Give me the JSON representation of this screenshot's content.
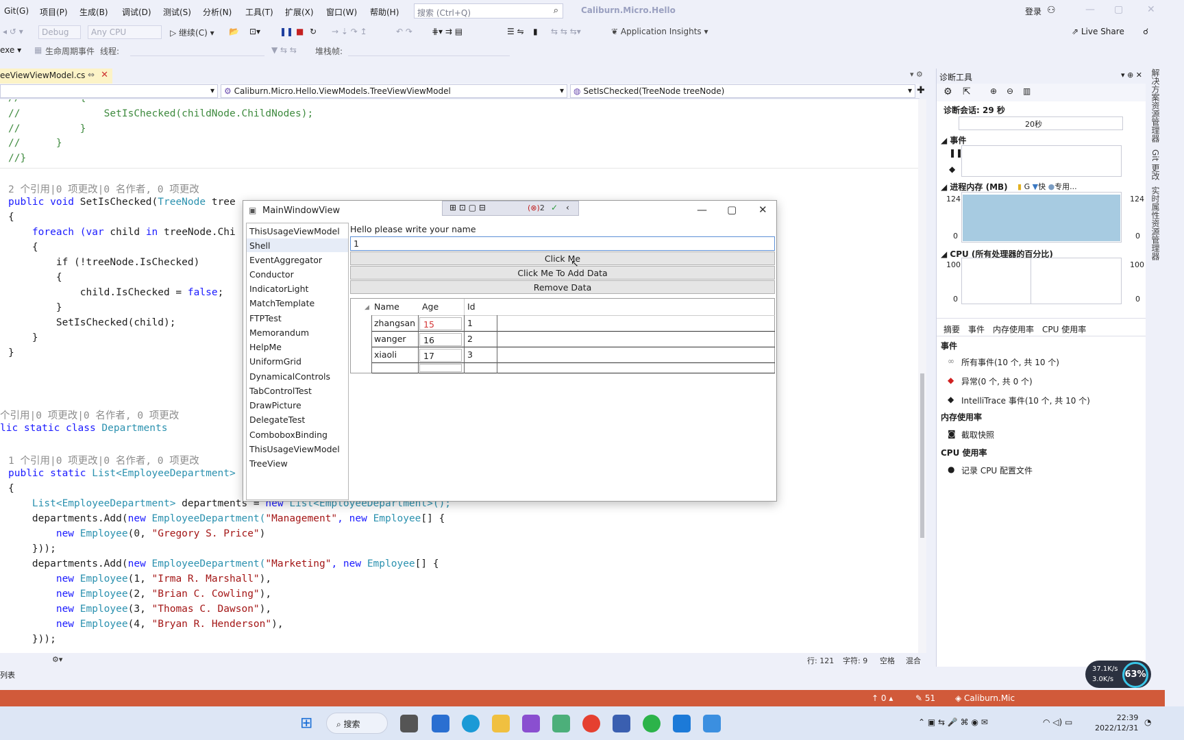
{
  "menu": {
    "items": [
      "Git(G)",
      "项目(P)",
      "生成(B)",
      "调试(D)",
      "测试(S)",
      "分析(N)",
      "工具(T)",
      "扩展(X)",
      "窗口(W)",
      "帮助(H)"
    ],
    "search_placeholder": "搜索 (Ctrl+Q)",
    "solution_title": "Caliburn.Micro.Hello",
    "login": "登录"
  },
  "toolbar": {
    "config": "Debug",
    "platform": "Any CPU",
    "continue": "继续(C)",
    "app_insights": "Application Insights",
    "live_share": "Live Share",
    "exe": "exe",
    "lifecycle": "生命周期事件",
    "thread": "线程:",
    "stackframe": "堆栈帧:"
  },
  "editor": {
    "tab_label": "eeViewViewModel.cs",
    "tab_pin": "⇔",
    "nav_class": "Caliburn.Micro.Hello.ViewModels.TreeViewViewModel",
    "nav_member": "SetIsChecked(TreeNode treeNode)",
    "status": {
      "line": "行: 121",
      "char": "字符: 9",
      "space": "空格",
      "mixed": "混合"
    },
    "bottom_tab": "列表"
  },
  "code": {
    "l1": "//          {",
    "l2": "//              SetIsChecked(childNode.ChildNodes);",
    "l3": "//          }",
    "l4": "//      }",
    "l5": "//}",
    "lens1": "2 个引用|0 项更改|0 名作者, 0 项更改",
    "l6a": "public void ",
    "l6b": "SetIsChecked(",
    "l6c": "TreeNode",
    "l6d": " tree",
    "l7": "{",
    "l8a": "    foreach (",
    "l8b": "var",
    "l8c": " child ",
    "l8d": "in",
    "l8e": " treeNode.Chi",
    "l9": "    {",
    "l10a": "        if (!treeNode.IsChecked)",
    "l11": "        {",
    "l12a": "            child.IsChecked = ",
    "l12b": "false",
    "l12c": ";",
    "l13": "        }",
    "l14": "        SetIsChecked(child);",
    "l15": "    }",
    "l16": "}",
    "lens2": "个引用|0 项更改|0 名作者, 0 项更改",
    "l17a": "lic static class ",
    "l17b": "Departments",
    "lens3": "1 个引用|0 项更改|0 名作者, 0 项更改",
    "l18a": "public static ",
    "l18b": "List<EmployeeDepartment>",
    "l19": "{",
    "l20a": "    List<EmployeeDepartment>",
    "l20b": " departments = ",
    "l20c": "new",
    "l20d": " List<EmployeeDepartment>();",
    "l21a": "    departments.Add(",
    "l21b": "new ",
    "l21c": "EmployeeDepartment(",
    "l21d": "\"Management\"",
    "l21e": ", new ",
    "l21f": "Employee",
    "l21g": "[] {",
    "l22a": "        new ",
    "l22b": "Employee",
    "l22c": "(0, ",
    "l22d": "\"Gregory S. Price\"",
    "l22e": ")",
    "l23": "    }));",
    "l24d": "\"Marketing\"",
    "e1": "(1, ",
    "e1n": "\"Irma R. Marshall\"",
    "e2": "(2, ",
    "e2n": "\"Brian C. Cowling\"",
    "e3": "(3, ",
    "e3n": "\"Thomas C. Dawson\"",
    "e4": "(4, ",
    "e4n": "\"Bryan R. Henderson\"",
    "comma_close": "),",
    "l29": "    }));"
  },
  "diag": {
    "title": "诊断工具",
    "session": "诊断会话: 29 秒",
    "ruler_label": "20秒",
    "events_section": "事件",
    "memory_section": "进程内存 (MB)",
    "memory_legend": [
      "G",
      "快",
      "专用..."
    ],
    "memory_ticks": {
      "max": "124",
      "min": "0"
    },
    "cpu_section": "CPU (所有处理器的百分比)",
    "cpu_ticks": {
      "max": "100",
      "min": "0"
    },
    "tabs": [
      "摘要",
      "事件",
      "内存使用率",
      "CPU 使用率"
    ],
    "events_title": "事件",
    "events": [
      "所有事件(10 个, 共 10 个)",
      "异常(0 个, 共 0 个)",
      "IntelliTrace 事件(10 个, 共 10 个)"
    ],
    "mem_title": "内存使用率",
    "mem_action": "截取快照",
    "cpu_title": "CPU 使用率",
    "cpu_action": "记录 CPU 配置文件"
  },
  "right_strip": [
    "解决方案资源管理器",
    "Git 更改",
    "实时属性资源管理器"
  ],
  "app": {
    "title": "MainWindowView",
    "debug_count": "2",
    "nav_items": [
      "ThisUsageViewModel",
      "Shell",
      "EventAggregator",
      "Conductor",
      "IndicatorLight",
      "MatchTemplate",
      "FTPTest",
      "Memorandum",
      "HelpMe",
      "UniformGrid",
      "DynamicalControls",
      "TabControlTest",
      "DrawPicture",
      "DelegateTest",
      "ComboboxBinding",
      "ThisUsageViewModel",
      "TreeView"
    ],
    "prompt": "Hello please write your name",
    "name_value": "1",
    "btn_click": "Click Me",
    "btn_add": "Click Me To Add Data",
    "btn_remove": "Remove Data",
    "grid_headers": [
      "Name",
      "Age",
      "Id"
    ],
    "grid_rows": [
      {
        "name": "zhangsan",
        "age": "15",
        "id": "1"
      },
      {
        "name": "wanger",
        "age": "16",
        "id": "2"
      },
      {
        "name": "xiaoli",
        "age": "17",
        "id": "3"
      }
    ]
  },
  "vs_status": {
    "up": "0",
    "pencil": "51",
    "repo": "Caliburn.Mic"
  },
  "taskbar": {
    "search": "搜索",
    "time": "22:39",
    "date": "2022/12/31",
    "net_up": "37.1K/s",
    "net_down": "3.0K/s",
    "cpu_pct": "63%"
  },
  "colors": {
    "accent": "#d15a3a",
    "memory_fill": "#a7cbe1",
    "age_red": "#d33434"
  }
}
